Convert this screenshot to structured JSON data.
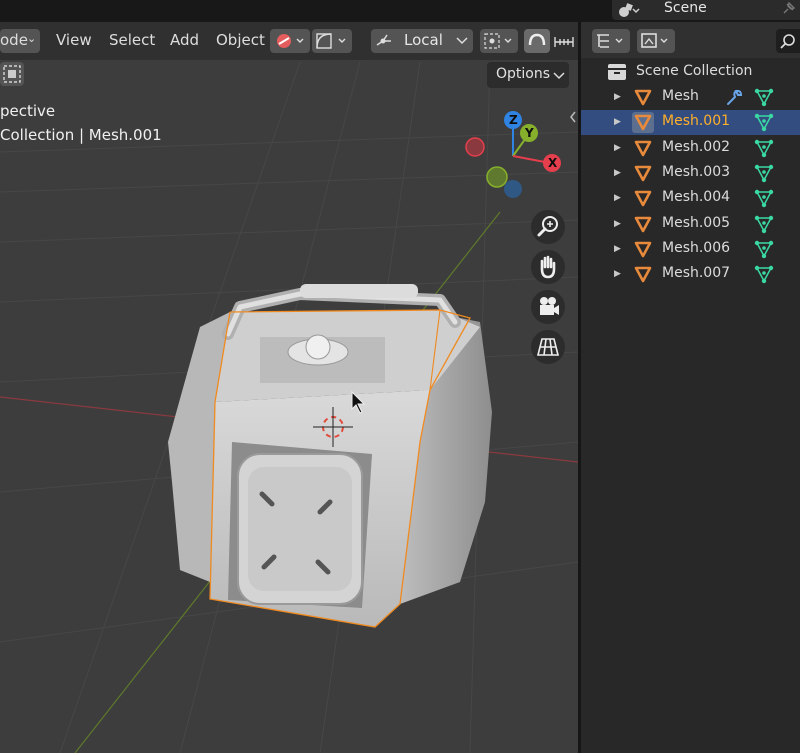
{
  "topbar": {
    "scene_name": "Scene"
  },
  "viewport_header": {
    "mode_label": "ode",
    "menus": [
      "View",
      "Select",
      "Add",
      "Object"
    ],
    "transform_orientation": "Local",
    "options_label": "Options"
  },
  "viewport_overlay": {
    "view_name": "pective",
    "collection_path": "Collection | Mesh.001"
  },
  "gizmo": {
    "z_label": "Z",
    "y_label": "Y",
    "x_label": "X",
    "colors": {
      "x": "#e53e4d",
      "y": "#86b02c",
      "z": "#2f83e3"
    }
  },
  "navigation_tools": [
    "zoom-icon",
    "hand-icon",
    "camera-icon",
    "grid-icon"
  ],
  "outliner": {
    "root_label": "Scene Collection",
    "items": [
      {
        "label": "Mesh",
        "selected": false,
        "has_modifier": true
      },
      {
        "label": "Mesh.001",
        "selected": true,
        "has_modifier": false
      },
      {
        "label": "Mesh.002",
        "selected": false,
        "has_modifier": false
      },
      {
        "label": "Mesh.003",
        "selected": false,
        "has_modifier": false
      },
      {
        "label": "Mesh.004",
        "selected": false,
        "has_modifier": false
      },
      {
        "label": "Mesh.005",
        "selected": false,
        "has_modifier": false
      },
      {
        "label": "Mesh.006",
        "selected": false,
        "has_modifier": false
      },
      {
        "label": "Mesh.007",
        "selected": false,
        "has_modifier": false
      }
    ]
  },
  "colors": {
    "accent_orange": "#ffaf29",
    "mesh_icon_orange": "#e88a3c",
    "mesh_data_green": "#3ad9a3",
    "selection_blue": "#334d80"
  }
}
